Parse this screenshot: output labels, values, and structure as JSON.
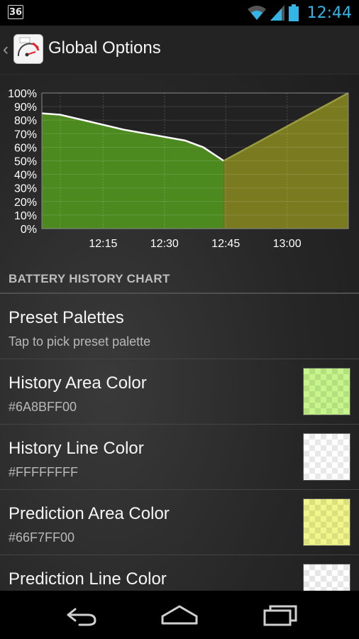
{
  "status_bar": {
    "notification_badge": "36",
    "icons": [
      "wifi-icon",
      "cell-signal-icon",
      "battery-icon"
    ],
    "time": "12:44",
    "clock_color": "#33b5e5"
  },
  "action_bar": {
    "title": "Global Options",
    "icons": [
      "back-chevron-icon",
      "gauge-app-icon"
    ]
  },
  "chart_data": {
    "type": "area",
    "y_ticks": [
      "100%",
      "90%",
      "80%",
      "70%",
      "60%",
      "50%",
      "40%",
      "30%",
      "20%",
      "10%",
      "0%"
    ],
    "x_ticks": [
      "12:15",
      "12:30",
      "12:45",
      "13:00"
    ],
    "x_tick_minutes": [
      15,
      30,
      45,
      60
    ],
    "ylim": [
      0,
      100
    ],
    "xlim_minutes": [
      0,
      75
    ],
    "grid": true,
    "series": [
      {
        "x_minutes": [
          0,
          4.5,
          20,
          35,
          39.5,
          44.5
        ],
        "values": [
          85,
          84,
          73,
          65,
          60,
          50
        ],
        "area_color": "#4c8a1f",
        "line_color": "#FFFFFF"
      },
      {
        "x_minutes": [
          44.5,
          75
        ],
        "values": [
          50,
          100
        ],
        "area_color": "#7a7a20",
        "line_color": "#9a9a40"
      }
    ]
  },
  "section": {
    "header": "BATTERY HISTORY CHART"
  },
  "preferences": [
    {
      "title": "Preset Palettes",
      "summary": "Tap to pick preset palette",
      "color": null
    },
    {
      "title": "History Area Color",
      "summary": "#6A8BFF00",
      "color": "#c6f58c"
    },
    {
      "title": "History Line Color",
      "summary": "#FFFFFFFF",
      "color": "#ffffff"
    },
    {
      "title": "Prediction Area Color",
      "summary": "#66F7FF00",
      "color": "#f2f58a"
    },
    {
      "title": "Prediction Line Color",
      "summary": "",
      "color": "#ffffff"
    }
  ],
  "nav_bar": {
    "buttons": [
      "back-icon",
      "home-icon",
      "recent-apps-icon"
    ]
  }
}
